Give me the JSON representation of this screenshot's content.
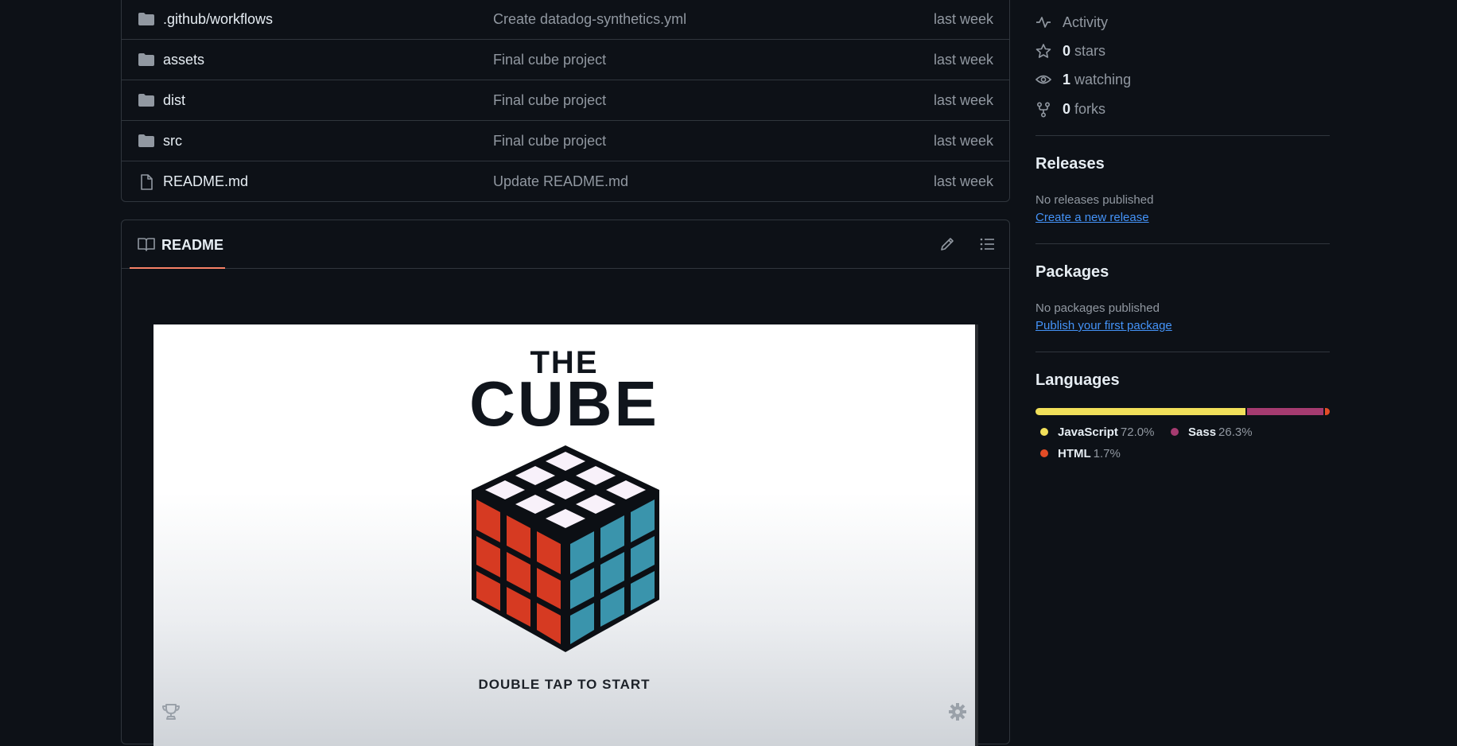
{
  "files": [
    {
      "name": ".github/workflows",
      "type": "folder",
      "message": "Create datadog-synthetics.yml",
      "age": "last week"
    },
    {
      "name": "assets",
      "type": "folder",
      "message": "Final cube project",
      "age": "last week"
    },
    {
      "name": "dist",
      "type": "folder",
      "message": "Final cube project",
      "age": "last week"
    },
    {
      "name": "src",
      "type": "folder",
      "message": "Final cube project",
      "age": "last week"
    },
    {
      "name": "README.md",
      "type": "file",
      "message": "Update README.md",
      "age": "last week"
    }
  ],
  "readme": {
    "tab_label": "README",
    "preview": {
      "title_small": "THE",
      "title_big": "CUBE",
      "cta": "DOUBLE TAP TO START"
    }
  },
  "sidebar": {
    "stats": [
      {
        "icon": "pulse-icon",
        "count": "",
        "label": "Activity"
      },
      {
        "icon": "star-icon",
        "count": "0",
        "label": "stars"
      },
      {
        "icon": "eye-icon",
        "count": "1",
        "label": "watching"
      },
      {
        "icon": "fork-icon",
        "count": "0",
        "label": "forks"
      }
    ],
    "releases": {
      "title": "Releases",
      "text": "No releases published",
      "link": "Create a new release"
    },
    "packages": {
      "title": "Packages",
      "text": "No packages published",
      "link": "Publish your first package"
    },
    "languages": {
      "title": "Languages",
      "items": [
        {
          "name": "JavaScript",
          "percent": "72.0%",
          "value": 72.0,
          "color": "#f1e05a"
        },
        {
          "name": "Sass",
          "percent": "26.3%",
          "value": 26.3,
          "color": "#a53b70"
        },
        {
          "name": "HTML",
          "percent": "1.7%",
          "value": 1.7,
          "color": "#e34c26"
        }
      ]
    }
  },
  "colors": {
    "background": "#0d1117",
    "border": "#30363d",
    "link": "#4493f8",
    "tab_underline": "#f78166",
    "cube_red": "#d63a22",
    "cube_teal": "#3a94ac",
    "cube_white": "#f8f1fa"
  }
}
